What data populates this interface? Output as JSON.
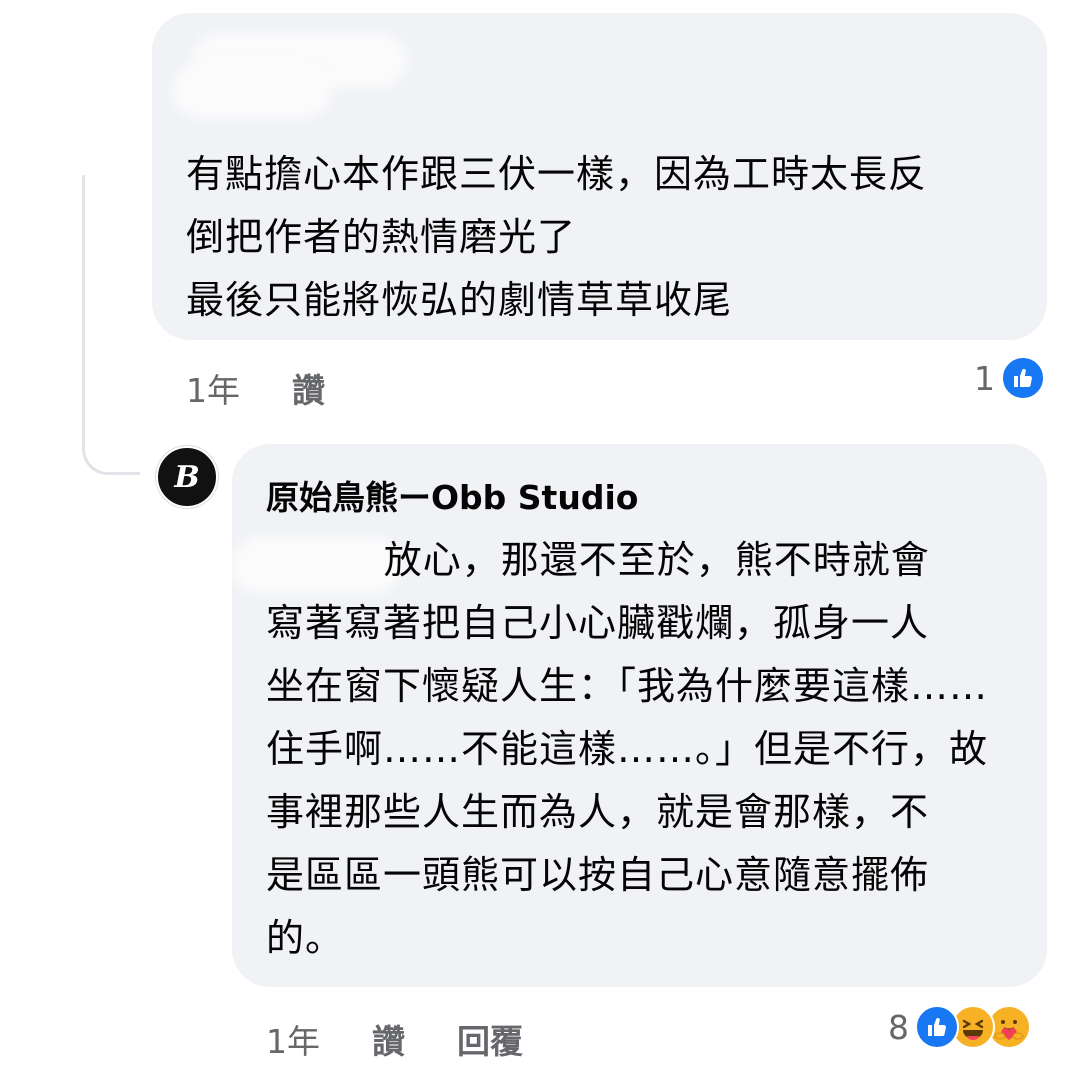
{
  "comment1": {
    "text": "有點擔心本作跟三伏一樣，因為工時太長反\n倒把作者的熱情磨光了\n最後只能將恢弘的劇情草草收尾",
    "time": "1年",
    "like_label": "讚",
    "reaction_count": "1"
  },
  "comment2": {
    "author": "原始鳥熊ーObb Studio",
    "avatar_letter": "B",
    "text": "         放心，那還不至於，熊不時就會\n寫著寫著把自己小心臟戳爛，孤身一人\n坐在窗下懷疑人生：「我為什麼要這樣……\n住手啊……不能這樣……。」但是不行，故\n事裡那些人生而為人，就是會那樣，不\n是區區一頭熊可以按自己心意隨意擺佈\n的。",
    "time": "1年",
    "like_label": "讚",
    "reply_label": "回覆",
    "reaction_count": "8"
  },
  "colors": {
    "bubble": "#f0f2f5",
    "like_blue": "#1877f2",
    "meta_gray": "#65676b",
    "emoji_yellow": "#f7b125"
  },
  "icons": [
    "like-icon",
    "haha-icon",
    "care-icon"
  ]
}
